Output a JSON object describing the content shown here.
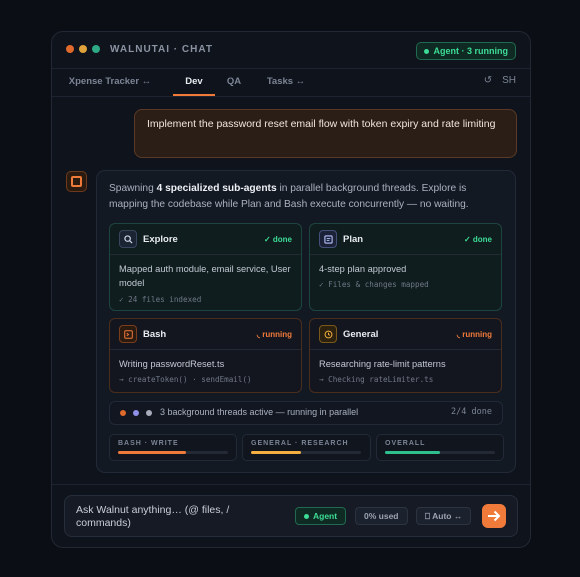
{
  "window": {
    "title": "WALNUTAI · CHAT",
    "agent_status": "Agent · 3 running"
  },
  "tabs": [
    {
      "label": "Xpense Tracker ↔",
      "active": false
    },
    {
      "label": "Dev",
      "active": true
    },
    {
      "label": "QA",
      "active": false
    },
    {
      "label": "Tasks ↔",
      "active": false
    }
  ],
  "tab_icons": {
    "refresh": "↺",
    "user": "SH"
  },
  "user_message": "Implement the password reset email flow with token expiry and rate limiting",
  "reply": {
    "intro_pre": "Spawning ",
    "intro_bold": "4 specialized sub-agents",
    "intro_post": " in parallel background threads. Explore is mapping the codebase while Plan and Bash execute concurrently — no waiting.",
    "agents": [
      {
        "name": "Explore",
        "status": "✓ done",
        "icon": "search-icon",
        "desc": "Mapped auth module, email service, User model",
        "sub": "✓ 24 files indexed"
      },
      {
        "name": "Plan",
        "status": "✓ done",
        "icon": "plan-icon",
        "desc": "4-step plan approved",
        "sub": "✓ Files & changes mapped"
      },
      {
        "name": "Bash",
        "status": "◟ running",
        "icon": "terminal-icon",
        "desc": "Writing passwordReset.ts",
        "sub": "→ createToken() · sendEmail()"
      },
      {
        "name": "General",
        "status": "◟ running",
        "icon": "clock-icon",
        "desc": "Researching rate-limit patterns",
        "sub": "→ Checking rateLimiter.ts"
      }
    ],
    "threads_text": "3 background threads active — running in parallel",
    "threads_count": "2/4 done",
    "meters": [
      {
        "label": "BASH · WRITE",
        "progress": 0.62,
        "color": "#f07a3a"
      },
      {
        "label": "GENERAL · RESEARCH",
        "progress": 0.45,
        "color": "#f5b041"
      },
      {
        "label": "OVERALL",
        "progress": 0.5,
        "color": "#2fbf8f"
      }
    ]
  },
  "composer": {
    "placeholder": "Ask Walnut anything… (@ files, / commands)",
    "agent_chip": "Agent",
    "usage_chip": "0% used",
    "auto_chip": "⎕ Auto ↔"
  },
  "colors": {
    "accent": "#f07a3a",
    "done": "#3ddc97",
    "running": "#f07a3a"
  }
}
